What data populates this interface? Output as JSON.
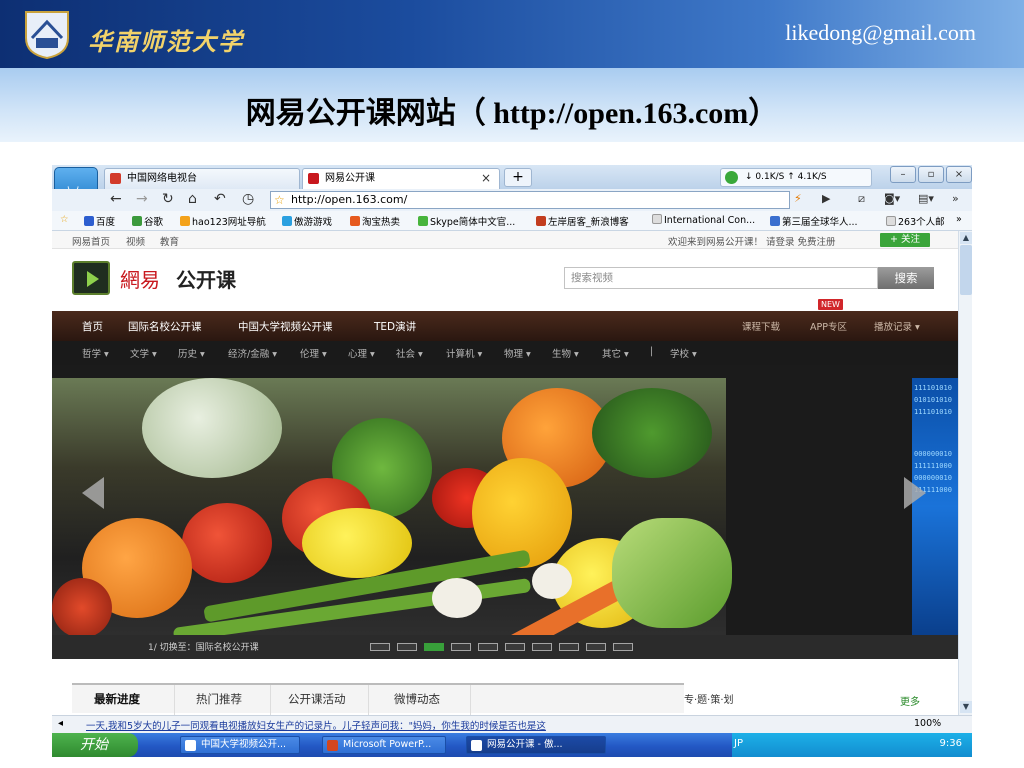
{
  "slide": {
    "university": "华南师范大学",
    "email": "likedong@gmail.com",
    "title": "网易公开课网站（ http://open.163.com）"
  },
  "browser": {
    "tabs": [
      {
        "label": "中国网络电视台",
        "active": false
      },
      {
        "label": "网易公开课",
        "active": true
      }
    ],
    "new_tab": "+",
    "speed": "↓ 0.1K/S  ↑ 4.1K/S",
    "address": "http://open.163.com/",
    "favorites": [
      "百度",
      "谷歌",
      "hao123网址导航",
      "傲游游戏",
      "淘宝热卖",
      "Skype简体中文官...",
      "左岸居客_新浪博客",
      "International Con...",
      "第三届全球华人...",
      "263个人邮"
    ]
  },
  "page": {
    "topline_left": [
      "网易首页",
      "视频",
      "教育"
    ],
    "topline_right": "欢迎来到网易公开课！  请登录  免费注册",
    "follow": "+ 关注",
    "brand_netease": "網易",
    "brand_open": "公开课",
    "search_placeholder": "搜索视频",
    "search_button": "搜索",
    "main_nav": [
      "首页",
      "国际名校公开课",
      "中国大学视频公开课",
      "TED演讲"
    ],
    "main_nav_right": [
      "课程下载",
      "APP专区",
      "播放记录 ▾"
    ],
    "new_badge": "NEW",
    "sub_nav": [
      "哲学 ▾",
      "文学 ▾",
      "历史 ▾",
      "经济/金融 ▾",
      "伦理 ▾",
      "心理 ▾",
      "社会 ▾",
      "计算机 ▾",
      "物理 ▾",
      "生物 ▾",
      "其它 ▾",
      "|",
      "学校 ▾"
    ],
    "caption": "1/ 切换至：国际名校公开课",
    "carousel_active": 3,
    "carousel_count": 10,
    "content_tabs": [
      "最新进度",
      "热门推荐",
      "公开课活动",
      "微博动态"
    ],
    "side_head": "专·题·策·划",
    "more": "更多"
  },
  "status": {
    "text": "一天,我和5岁大的儿子一同观看电视播放妇女生产的记录片。儿子轻声问我：\"妈妈，你生我的时候是否也是这",
    "zoom": "100%"
  },
  "taskbar": {
    "start": "开始",
    "tasks": [
      "中国大学视频公开...",
      "Microsoft PowerP...",
      "网易公开课 - 傲..."
    ],
    "lang": "JP",
    "clock": "9:36"
  },
  "colors": {
    "brand_red": "#c8181e",
    "nav_brown": "#3a2015",
    "follow_green": "#3aa53a",
    "banner_blue": "#1b4c9e"
  }
}
